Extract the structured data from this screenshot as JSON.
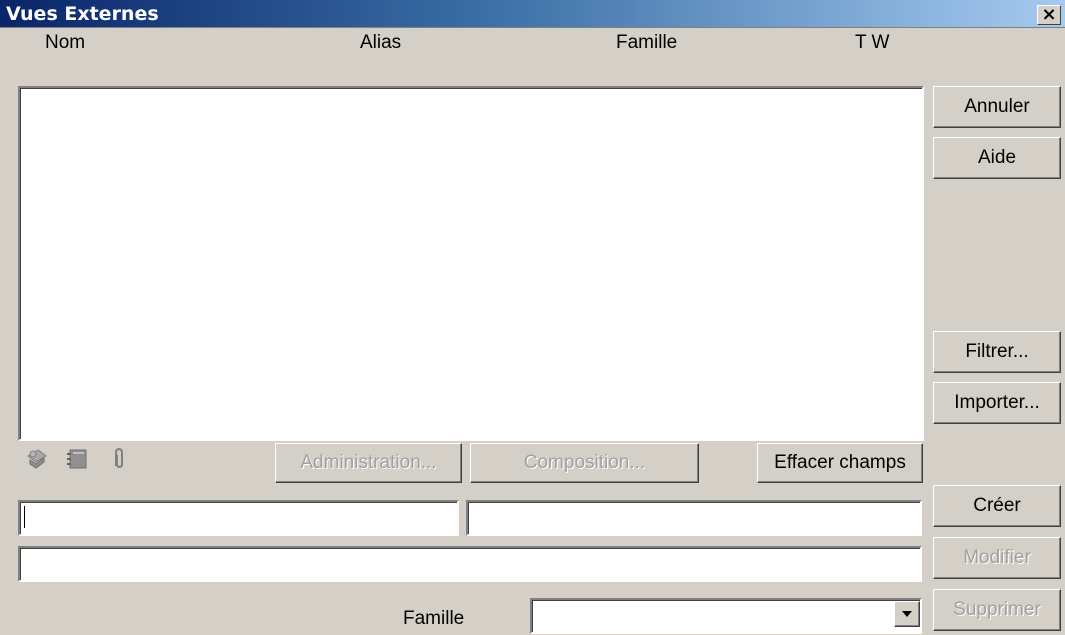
{
  "window": {
    "title": "Vues Externes",
    "close_glyph": "×"
  },
  "columns": {
    "nom": "Nom",
    "alias": "Alias",
    "famille": "Famille",
    "tw": "T W"
  },
  "side_buttons": {
    "annuler": "Annuler",
    "aide": "Aide",
    "filtrer": "Filtrer...",
    "importer": "Importer...",
    "creer": "Créer",
    "modifier": "Modifier",
    "supprimer": "Supprimer"
  },
  "toolbar": {
    "administration": "Administration...",
    "composition": "Composition...",
    "effacer": "Effacer champs",
    "icons": [
      "hand-sheet-icon",
      "notebook-icon",
      "paperclip-icon"
    ]
  },
  "fields": {
    "nom_value": "",
    "alias_value": "",
    "description_value": "",
    "famille_label": "Famille",
    "famille_value": ""
  },
  "colors": {
    "face": "#d4d0c8",
    "title_start": "#0a246a",
    "title_end": "#a6caf0",
    "disabled_text": "#a0a0a0"
  }
}
